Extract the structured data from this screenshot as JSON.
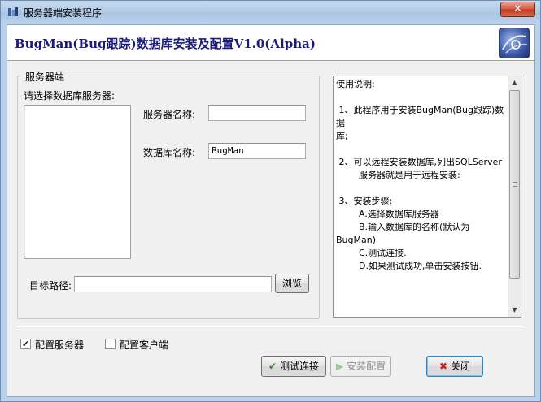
{
  "window": {
    "title": "服务器端安装程序",
    "close_label": "✕"
  },
  "header": {
    "title": "BugMan(Bug跟踪)数据库安装及配置V1.0(Alpha)"
  },
  "server_group": {
    "caption": "服务器端",
    "select_label": "请选择数据库服务器:",
    "server_name_label": "服务器名称:",
    "server_name_value": "",
    "db_name_label": "数据库名称:",
    "db_name_value": "BugMan",
    "target_path_label": "目标路径:",
    "target_path_value": "",
    "browse_label": "浏览"
  },
  "instructions": {
    "text": "使用说明:\n\n 1、此程序用于安装BugMan(Bug跟踪)数\n据\n库;\n\n 2、可以远程安装数据库,列出SQLServer\n        服务器就是用于远程安装:\n\n 3、安装步骤:\n        A.选择数据库服务器\n        B.输入数据库的名称(默认为BugMan)\n        C.测试连接.\n        D.如果测试成功,单击安装按钮."
  },
  "options": {
    "config_server_label": "配置服务器",
    "config_server_checked": true,
    "config_client_label": "配置客户端",
    "config_client_checked": false
  },
  "actions": {
    "test_label": "测试连接",
    "install_label": "安装配置",
    "close_label": "关闭"
  },
  "colors": {
    "header_title": "#1a1a7a",
    "test_icon": "#2e8b2e",
    "close_icon": "#cc2020"
  }
}
